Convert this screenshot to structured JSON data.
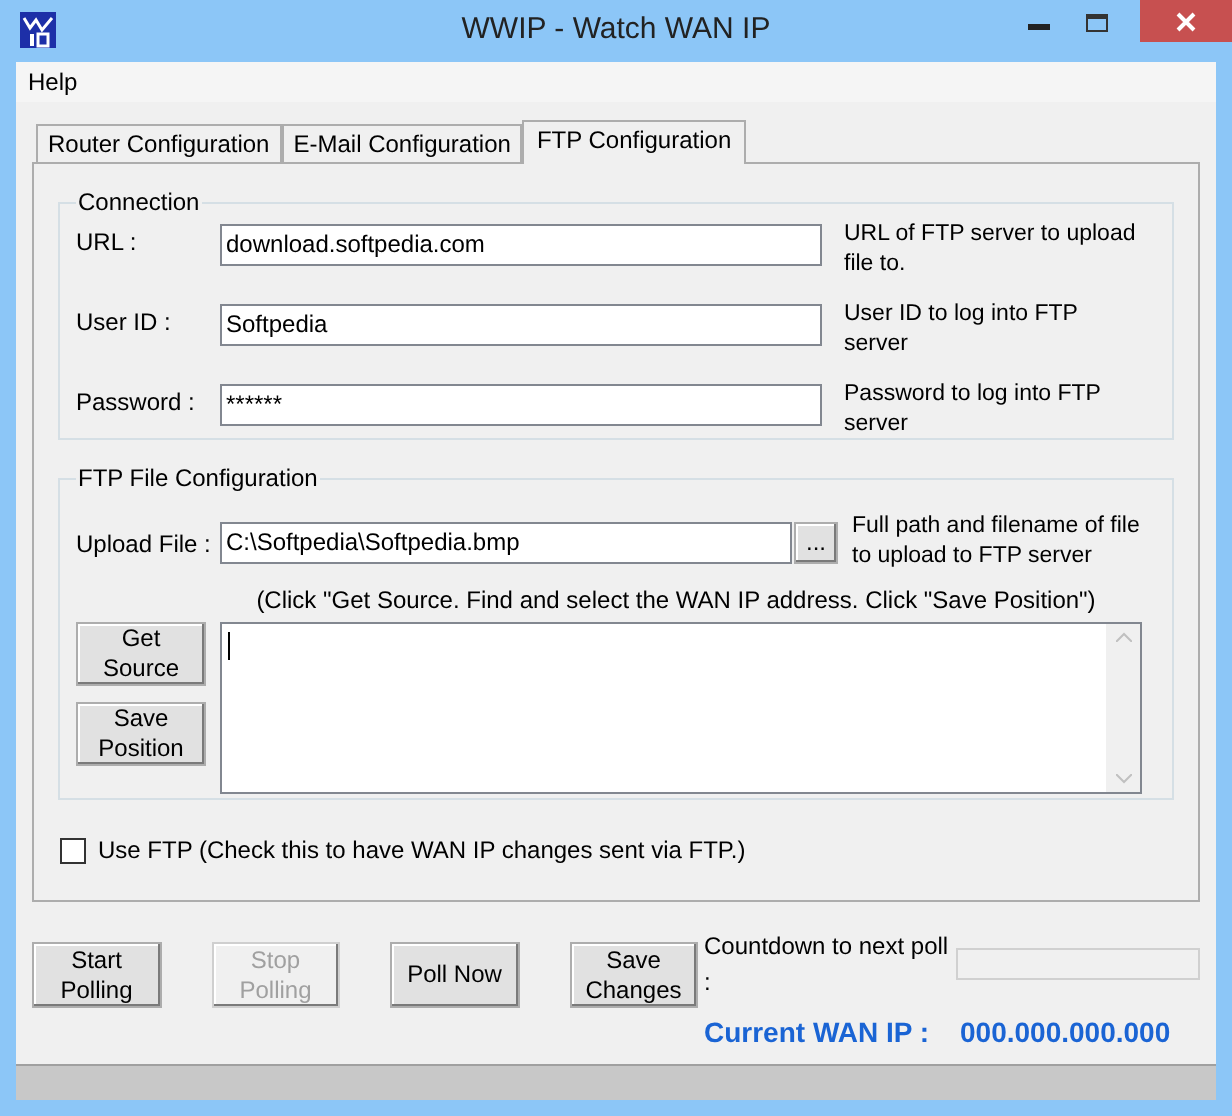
{
  "window": {
    "title": "WWIP - Watch WAN IP"
  },
  "menu": [
    "Help"
  ],
  "tabs": [
    {
      "label": "Router Configuration",
      "selected": false
    },
    {
      "label": "E-Mail Configuration",
      "selected": false
    },
    {
      "label": "FTP Configuration",
      "selected": true
    }
  ],
  "connection": {
    "title": "Connection",
    "fields": [
      {
        "label": "URL :",
        "value": "download.softpedia.com",
        "description": "URL of FTP server to upload file to."
      },
      {
        "label": "User ID :",
        "value": "Softpedia",
        "description": "User ID to log into FTP server"
      },
      {
        "label": "Password :",
        "value": "******",
        "description": "Password to log into FTP server"
      }
    ]
  },
  "ftp_file": {
    "title": "FTP File Configuration",
    "upload": {
      "label": "Upload File :",
      "value": "C:\\Softpedia\\Softpedia.bmp",
      "browse": "...",
      "description": "Full path and filename of file to upload to FTP server"
    },
    "instruction": "(Click \"Get Source. Find and select the WAN IP address. Click \"Save Position\")",
    "buttons": [
      "Get Source",
      "Save Position"
    ]
  },
  "use_ftp": {
    "label": "Use FTP (Check this to have WAN IP changes sent via FTP.)",
    "checked": false
  },
  "actions": [
    {
      "label": "Start Polling",
      "disabled": false
    },
    {
      "label": "Stop Polling",
      "disabled": true
    },
    {
      "label": "Poll Now",
      "disabled": false
    },
    {
      "label": "Save Changes",
      "disabled": false
    }
  ],
  "countdown": {
    "label": "Countdown to next poll :"
  },
  "current_ip": {
    "label": "Current WAN IP :",
    "value": "000.000.000.000"
  }
}
